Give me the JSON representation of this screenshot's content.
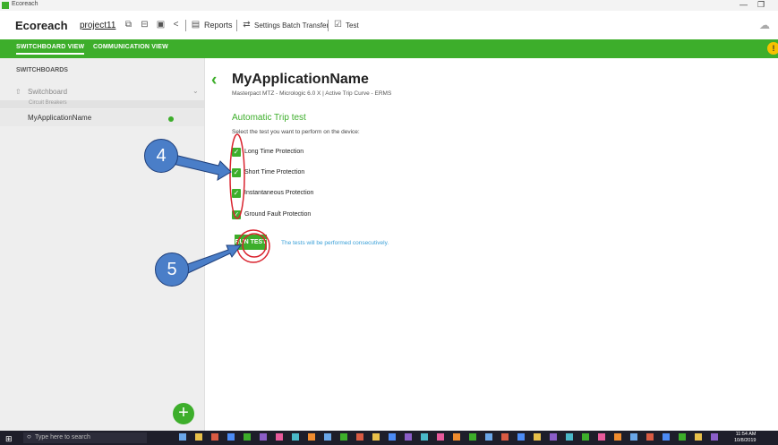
{
  "window": {
    "title": "Ecoreach",
    "minimize_glyph": "—",
    "maximize_glyph": "❐"
  },
  "toolbar": {
    "brand": "Ecoreach",
    "project": "project11",
    "reports_label": "Reports",
    "settings_batch_label": "Settings Batch Transfer",
    "test_label": "Test",
    "icons": [
      "screen-add-icon",
      "screen-remove-icon",
      "screen-icon",
      "share-icon",
      "document-icon",
      "batch-transfer-icon",
      "test-checklist-icon",
      "cloud-icon"
    ]
  },
  "nav": {
    "tabs": [
      {
        "label": "SWITCHBOARD VIEW",
        "active": true
      },
      {
        "label": "COMMUNICATION VIEW",
        "active": false
      }
    ],
    "warning_glyph": "!"
  },
  "sidebar": {
    "heading": "SWITCHBOARDS",
    "switchboard_label": "Switchboard",
    "group_label": "Circuit Breakers",
    "items": [
      {
        "label": "MyApplicationName",
        "status": "connected"
      }
    ],
    "add_glyph": "+"
  },
  "main": {
    "back_glyph": "‹",
    "title": "MyApplicationName",
    "subtitle": "Masterpact MTZ - Micrologic 6.0 X   |   Active Trip Curve  -  ERMS",
    "section_title": "Automatic Trip test",
    "instruction": "Select the test you want to perform on the device:",
    "options": [
      {
        "label": "Long Time Protection",
        "checked": true
      },
      {
        "label": "Short Time Protection",
        "checked": true
      },
      {
        "label": "Instantaneous Protection",
        "checked": true
      },
      {
        "label": "Ground Fault Protection",
        "checked": true
      }
    ],
    "run_button": "RUN TEST",
    "note": "The tests will be performed consecutively."
  },
  "annotations": {
    "step_a": "4",
    "step_b": "5"
  },
  "taskbar": {
    "search_placeholder": "Type here to search",
    "time": "11:54 AM",
    "date": "10/8/2019"
  },
  "colors": {
    "brand_green": "#3dae2b",
    "annotation_red": "#d9232e",
    "annotation_blue": "#4a7ec8",
    "link_blue": "#3aa0d8"
  }
}
